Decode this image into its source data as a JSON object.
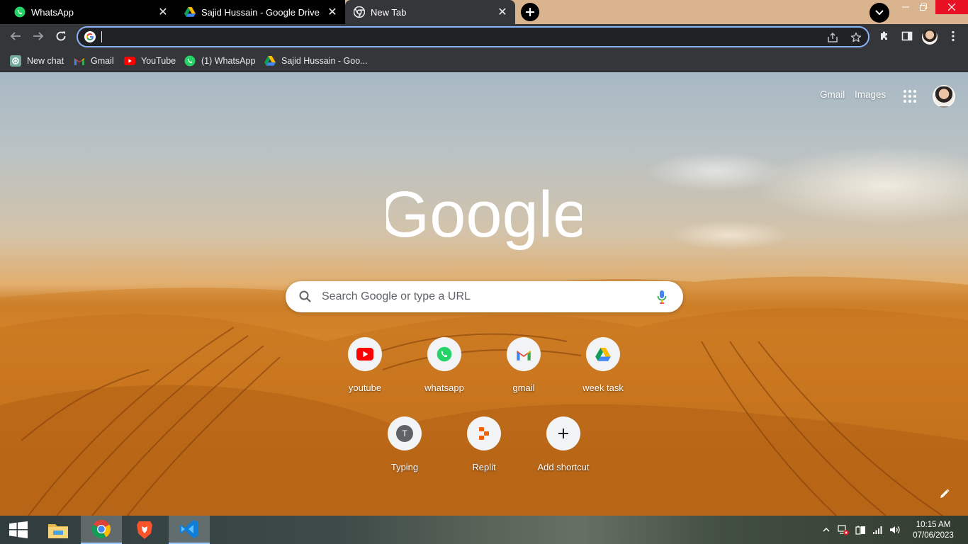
{
  "tabs": [
    {
      "title": "WhatsApp",
      "favicon": "whatsapp-icon",
      "state": "inactive"
    },
    {
      "title": "Sajid Hussain - Google Drive",
      "favicon": "google-drive-icon",
      "state": "inactive"
    },
    {
      "title": "New Tab",
      "favicon": "chrome-icon",
      "state": "active"
    }
  ],
  "toolbar": {
    "address_value": "",
    "back": "arrow-left-icon",
    "forward": "arrow-right-icon",
    "reload": "reload-icon"
  },
  "bookmarks": [
    {
      "label": "New chat",
      "icon": "chatgpt-icon"
    },
    {
      "label": "Gmail",
      "icon": "gmail-icon"
    },
    {
      "label": "YouTube",
      "icon": "youtube-icon"
    },
    {
      "label": "(1) WhatsApp",
      "icon": "whatsapp-icon"
    },
    {
      "label": "Sajid Hussain - Goo...",
      "icon": "google-drive-icon"
    }
  ],
  "ntp": {
    "links": {
      "gmail": "Gmail",
      "images": "Images"
    },
    "logo_text": "Google",
    "search_placeholder": "Search Google or type a URL",
    "shortcuts": [
      {
        "label": "youtube",
        "icon": "youtube-icon"
      },
      {
        "label": "whatsapp",
        "icon": "whatsapp-icon"
      },
      {
        "label": "gmail",
        "icon": "gmail-icon"
      },
      {
        "label": "week task",
        "icon": "google-drive-icon"
      },
      {
        "label": "Typing",
        "icon": "letter-t-icon",
        "letter": "T"
      },
      {
        "label": "Replit",
        "icon": "replit-icon"
      },
      {
        "label": "Add shortcut",
        "icon": "plus-icon"
      }
    ]
  },
  "taskbar": {
    "apps": [
      "windows-start-icon",
      "file-explorer-icon",
      "chrome-icon",
      "brave-icon",
      "vscode-icon"
    ],
    "time": "10:15 AM",
    "date": "07/06/2023"
  },
  "colors": {
    "focus_ring": "#8ab4f8",
    "toolbar_bg": "#35363a",
    "close_red": "#e81123"
  }
}
